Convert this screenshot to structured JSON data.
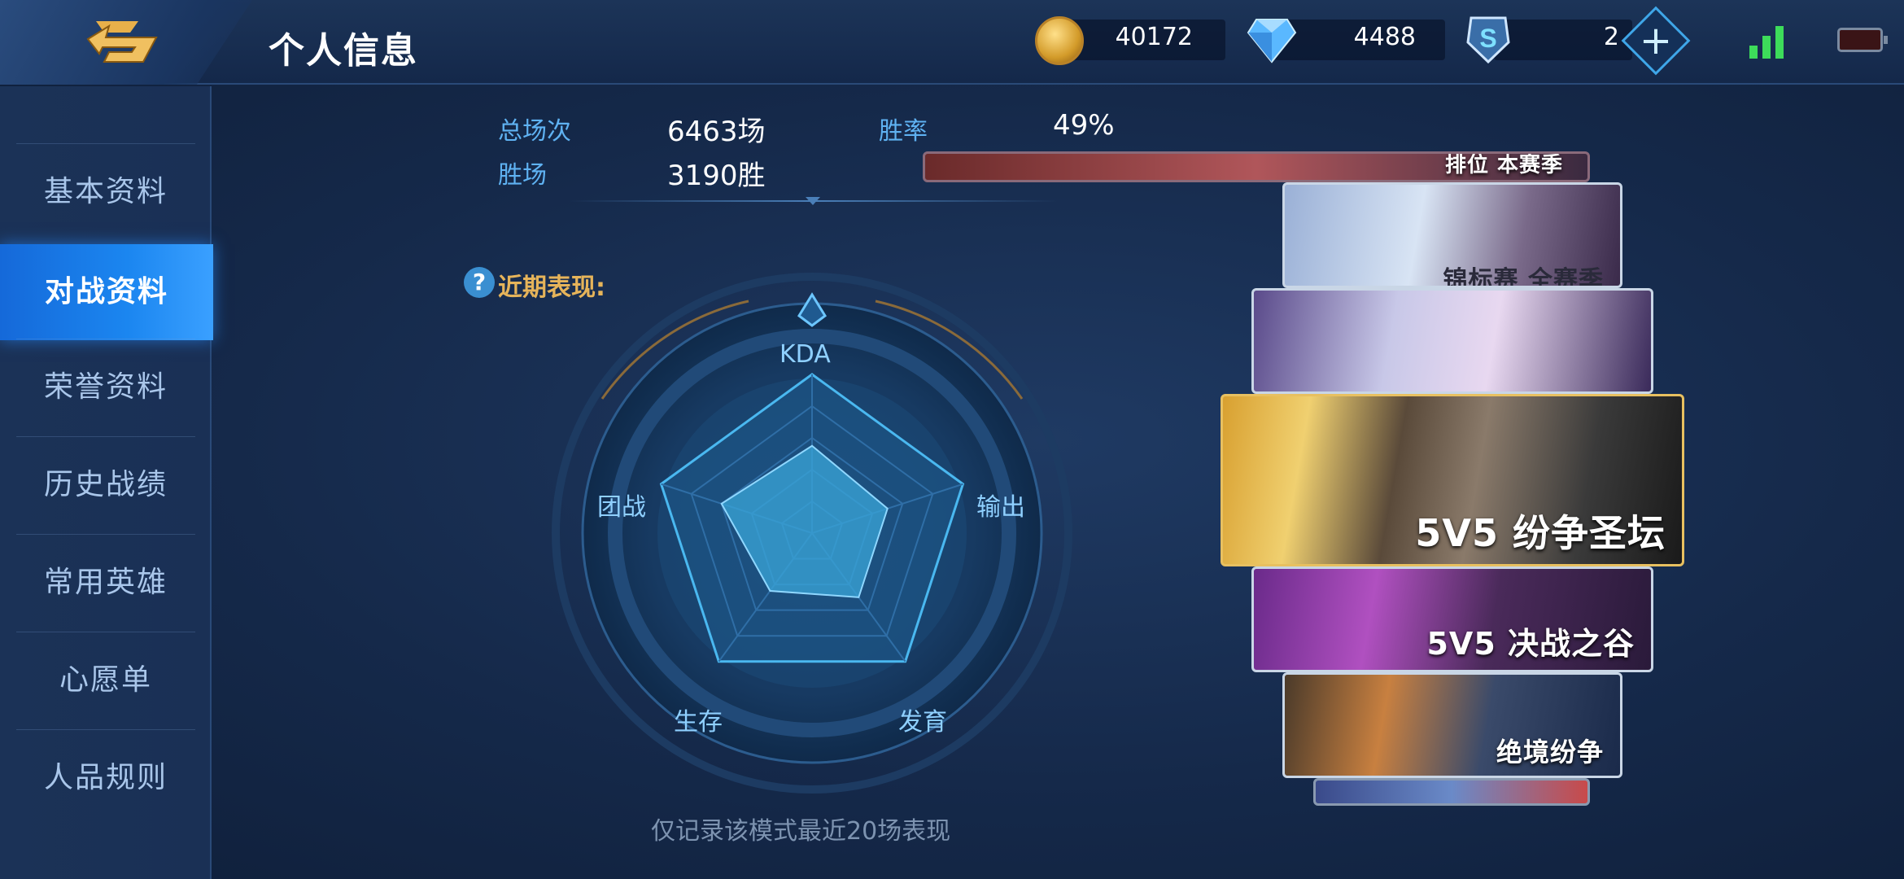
{
  "header": {
    "title": "个人信息",
    "gold": "40172",
    "diamonds": "4488",
    "tokens": "2",
    "plus_label": "+"
  },
  "sidebar": {
    "items": [
      {
        "label": "基本资料"
      },
      {
        "label": "对战资料"
      },
      {
        "label": "荣誉资料"
      },
      {
        "label": "历史战绩"
      },
      {
        "label": "常用英雄"
      },
      {
        "label": "心愿单"
      },
      {
        "label": "人品规则"
      }
    ],
    "active_index": 1
  },
  "stats": {
    "total_label": "总场次",
    "total_value": "6463场",
    "winrate_label": "胜率",
    "winrate_value": "49%",
    "wins_label": "胜场",
    "wins_value": "3190胜"
  },
  "recent": {
    "help_glyph": "?",
    "label": "近期表现:",
    "footnote": "仅记录该模式最近20场表现"
  },
  "chart_data": {
    "type": "radar",
    "axes": [
      "KDA",
      "输出",
      "发育",
      "生存",
      "团战"
    ],
    "values": [
      0.55,
      0.5,
      0.5,
      0.45,
      0.6
    ],
    "max": 1
  },
  "modes": [
    {
      "label": "排位 本赛季"
    },
    {
      "label": "锦标赛 全赛季"
    },
    {
      "label": ""
    },
    {
      "label": "5V5 纷争圣坛"
    },
    {
      "label": "5V5 决战之谷"
    },
    {
      "label": "绝境纷争"
    },
    {
      "label": ""
    }
  ],
  "colors": {
    "accent": "#1b86f0",
    "stat_label": "#5fb2f2",
    "recent_label": "#e6b45a",
    "radar_fill": "#3aa6d8"
  }
}
